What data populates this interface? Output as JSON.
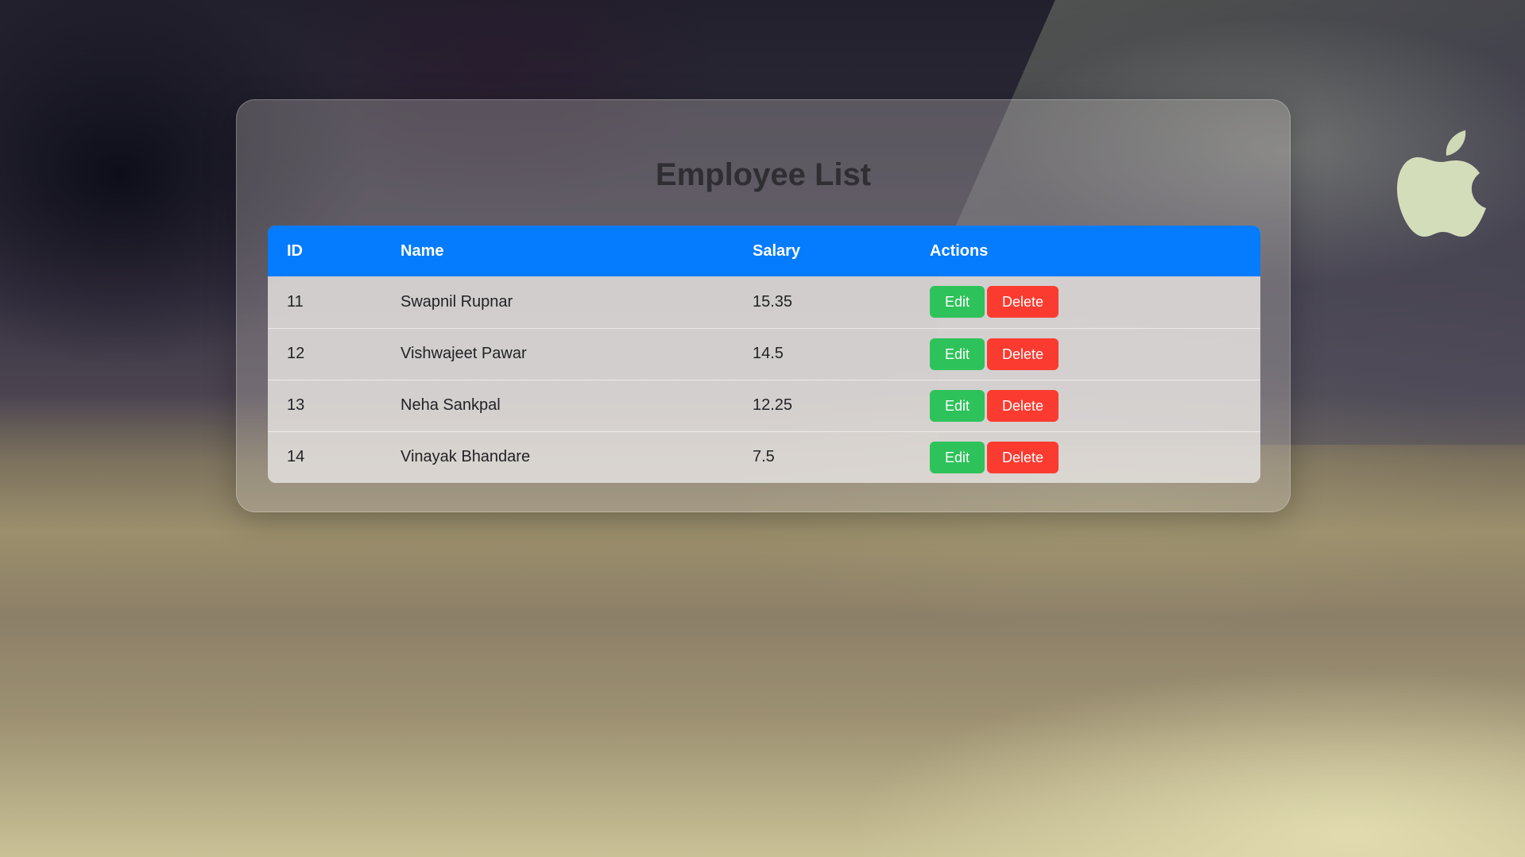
{
  "page": {
    "title": "Employee List"
  },
  "table": {
    "headers": {
      "id": "ID",
      "name": "Name",
      "salary": "Salary",
      "actions": "Actions"
    },
    "rows": [
      {
        "id": "11",
        "name": "Swapnil Rupnar",
        "salary": "15.35",
        "edit_label": "Edit",
        "delete_label": "Delete"
      },
      {
        "id": "12",
        "name": "Vishwajeet Pawar",
        "salary": "14.5",
        "edit_label": "Edit",
        "delete_label": "Delete"
      },
      {
        "id": "13",
        "name": "Neha Sankpal",
        "salary": "12.25",
        "edit_label": "Edit",
        "delete_label": "Delete"
      },
      {
        "id": "14",
        "name": "Vinayak Bhandare",
        "salary": "7.5",
        "edit_label": "Edit",
        "delete_label": "Delete"
      }
    ]
  },
  "colors": {
    "header_bg": "#057bfd",
    "edit_button": "#2ec25a",
    "delete_button": "#fb3b30"
  },
  "icons": {
    "background_logo": "apple-logo-icon"
  }
}
